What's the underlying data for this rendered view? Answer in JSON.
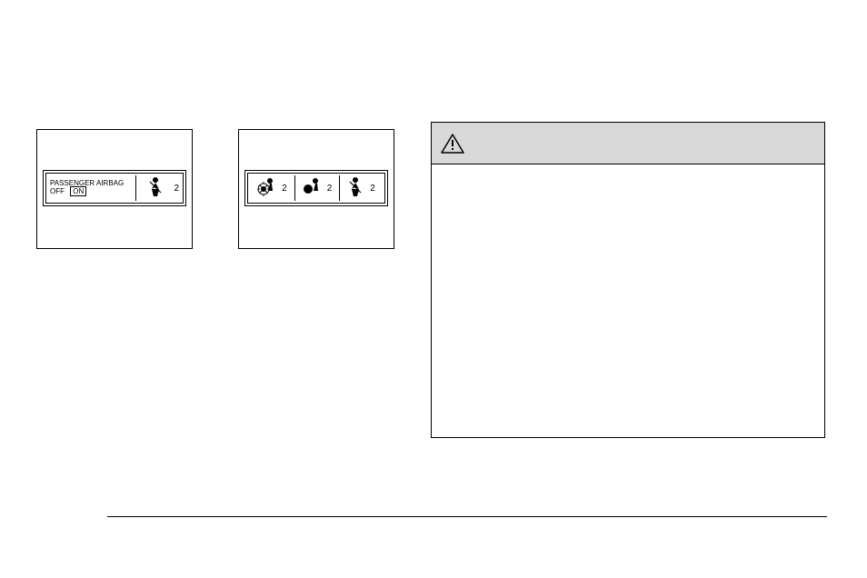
{
  "panel_a": {
    "line1": "PASSENGER AIRBAG",
    "line2": "OFF",
    "on_label": "ON",
    "seat_digit": "2"
  },
  "panel_b": {
    "digit1": "2",
    "digit2": "2",
    "seat_digit": "2"
  }
}
